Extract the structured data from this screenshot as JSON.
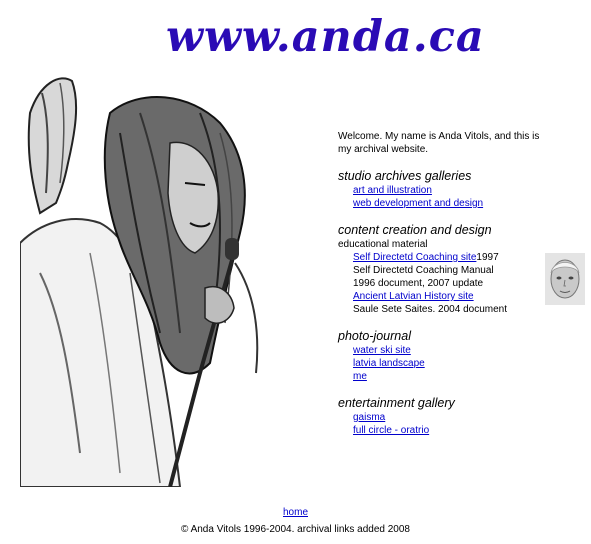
{
  "logo": {
    "text": "www.anda.ca"
  },
  "welcome": "Welcome. My name is Anda Vitols, and this is my archival website.",
  "studio": {
    "title": "studio archives galleries",
    "links": [
      "art and illustration",
      "web development and design"
    ]
  },
  "content_creation": {
    "title": "content creation and design",
    "subtitle": "educational material",
    "item1": {
      "link": "Self Directetd Coaching site",
      "year": "1997"
    },
    "item1_desc1": "Self Directetd Coaching Manual",
    "item1_desc2": "1996 document, 2007 update",
    "item2": {
      "link": "Ancient Latvian History site"
    },
    "item2_desc": "Saule Sete Saites. 2004 document"
  },
  "photo_journal": {
    "title": "photo-journal",
    "links": [
      "water ski site",
      "latvia landscape",
      "me"
    ]
  },
  "entertainment": {
    "title": "entertainment gallery",
    "links": [
      "gaisma",
      "full circle - oratrio"
    ]
  },
  "nav": {
    "home": "home"
  },
  "footer": "© Anda Vitols 1996-2004. archival links added 2008",
  "colors": {
    "logo": "#2a0bb5",
    "link": "#0000cc"
  }
}
